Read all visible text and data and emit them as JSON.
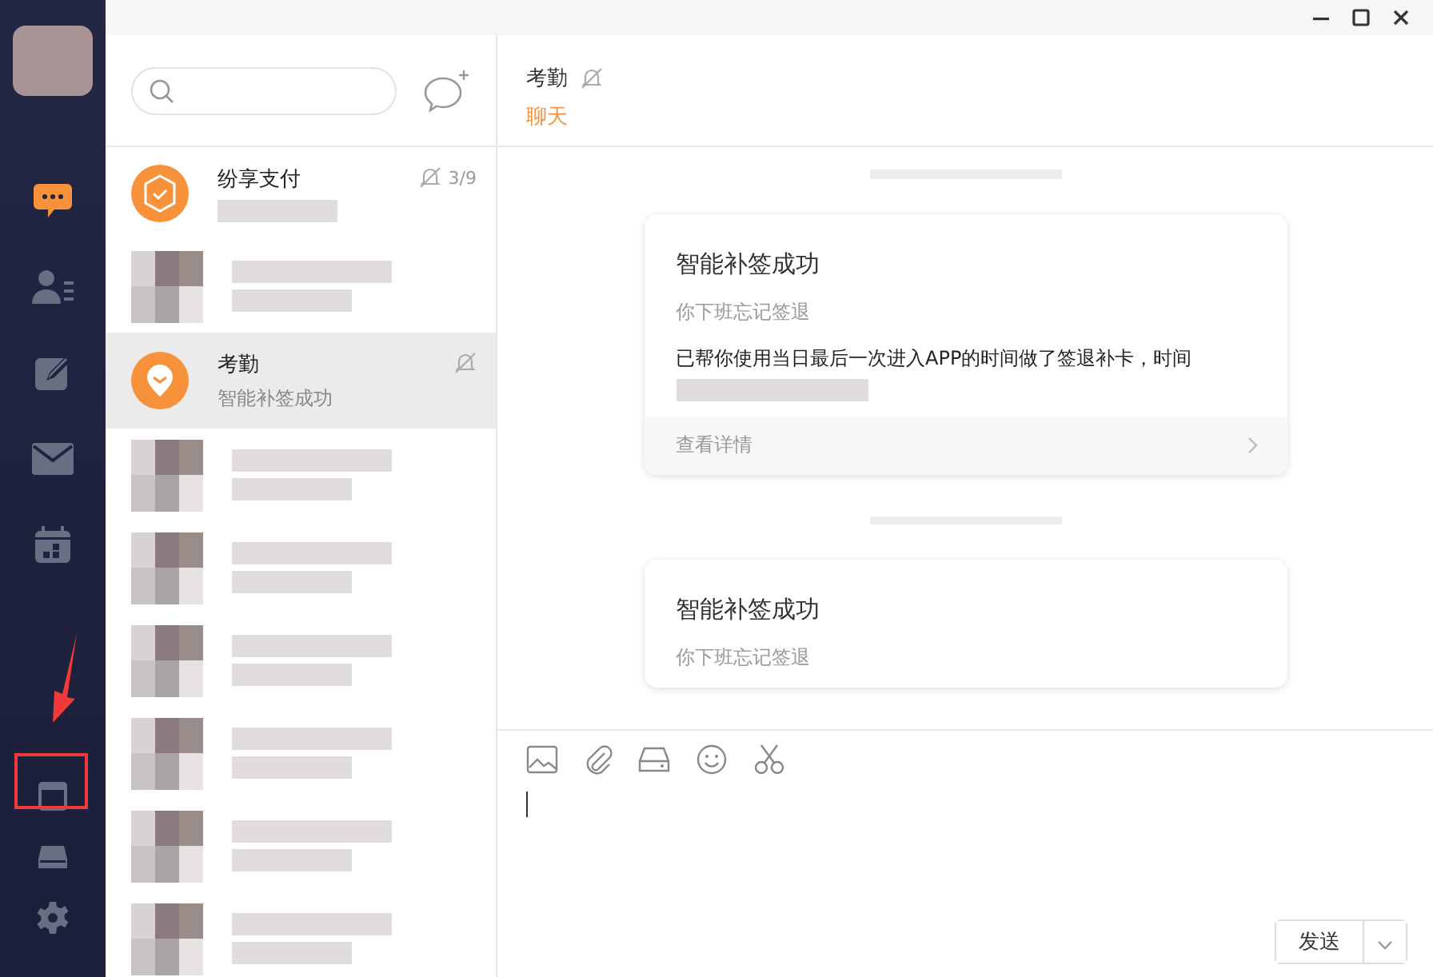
{
  "sidebar": {
    "items": [
      {
        "kind": "chat",
        "selected": true
      },
      {
        "kind": "contacts",
        "selected": false
      },
      {
        "kind": "edit",
        "selected": false
      },
      {
        "kind": "mail",
        "selected": false
      },
      {
        "kind": "calendar",
        "selected": false
      },
      {
        "kind": "window",
        "selected": false
      },
      {
        "kind": "drive",
        "selected": false
      },
      {
        "kind": "settings",
        "selected": false
      }
    ]
  },
  "conversations": [
    {
      "kind": "payment",
      "name": "纷享支付",
      "muted": true,
      "count": "3/9",
      "selected": false
    },
    {
      "kind": "redacted",
      "selected": false
    },
    {
      "kind": "attendance",
      "name": "考勤",
      "preview": "智能补签成功",
      "muted": true,
      "selected": true
    },
    {
      "kind": "redacted",
      "selected": false
    },
    {
      "kind": "redacted",
      "selected": false
    },
    {
      "kind": "redacted",
      "selected": false
    },
    {
      "kind": "redacted",
      "selected": false
    },
    {
      "kind": "redacted",
      "selected": false
    },
    {
      "kind": "redacted",
      "selected": false
    }
  ],
  "chat": {
    "title": "考勤",
    "muted": true,
    "tab": "聊天",
    "messages": [
      {
        "title": "智能补签成功",
        "subtitle": "你下班忘记签退",
        "body": "已帮你使用当日最后一次进入APP的时间做了签退补卡，时间",
        "link": "查看详情"
      },
      {
        "title": "智能补签成功",
        "subtitle": "你下班忘记签退"
      }
    ]
  },
  "composer": {
    "tools": [
      {
        "kind": "image"
      },
      {
        "kind": "attachment"
      },
      {
        "kind": "drive"
      },
      {
        "kind": "emoji"
      },
      {
        "kind": "scissors"
      }
    ],
    "send": "发送"
  }
}
